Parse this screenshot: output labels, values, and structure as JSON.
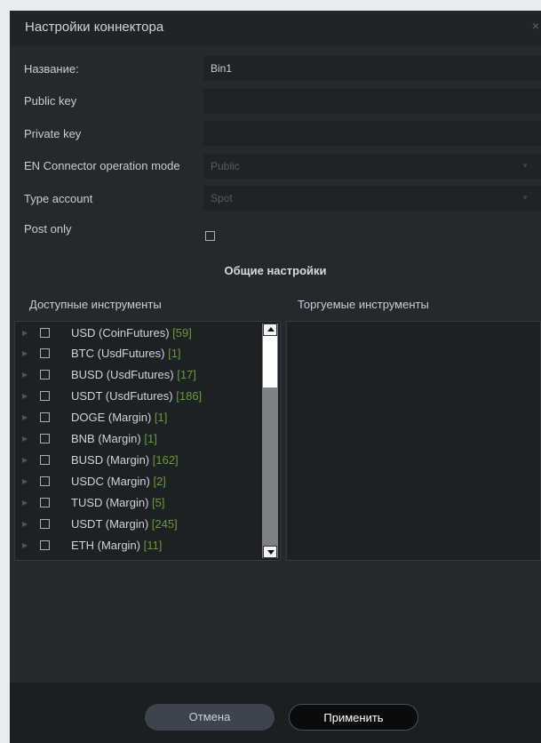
{
  "dialog": {
    "title": "Настройки коннектора",
    "close_glyph": "×"
  },
  "form": {
    "name_label": "Название:",
    "name_value": "Bin1",
    "public_key_label": "Public key",
    "public_key_value": "",
    "private_key_label": "Private key",
    "private_key_value": "",
    "mode_label": "EN Connector operation mode",
    "mode_value": "Public",
    "type_label": "Type account",
    "type_value": "Spot",
    "post_only_label": "Post only"
  },
  "section": {
    "title": "Общие настройки"
  },
  "available": {
    "header": "Доступные инструменты",
    "items": [
      {
        "name": "USD (CoinFutures)",
        "count": "[59]"
      },
      {
        "name": "BTC (UsdFutures)",
        "count": "[1]"
      },
      {
        "name": "BUSD (UsdFutures)",
        "count": "[17]"
      },
      {
        "name": "USDT (UsdFutures)",
        "count": "[186]"
      },
      {
        "name": "DOGE (Margin)",
        "count": "[1]"
      },
      {
        "name": "BNB (Margin)",
        "count": "[1]"
      },
      {
        "name": "BUSD (Margin)",
        "count": "[162]"
      },
      {
        "name": "USDC (Margin)",
        "count": "[2]"
      },
      {
        "name": "TUSD (Margin)",
        "count": "[5]"
      },
      {
        "name": "USDT (Margin)",
        "count": "[245]"
      },
      {
        "name": "ETH (Margin)",
        "count": "[11]"
      }
    ]
  },
  "traded": {
    "header": "Торгуемые инструменты"
  },
  "footer": {
    "cancel_label": "Отмена",
    "apply_label": "Применить"
  },
  "colors": {
    "background": "#25292d",
    "count_green": "#6a9a3c",
    "apply_button": "#0a0b0c",
    "cancel_button": "#3c454d"
  }
}
